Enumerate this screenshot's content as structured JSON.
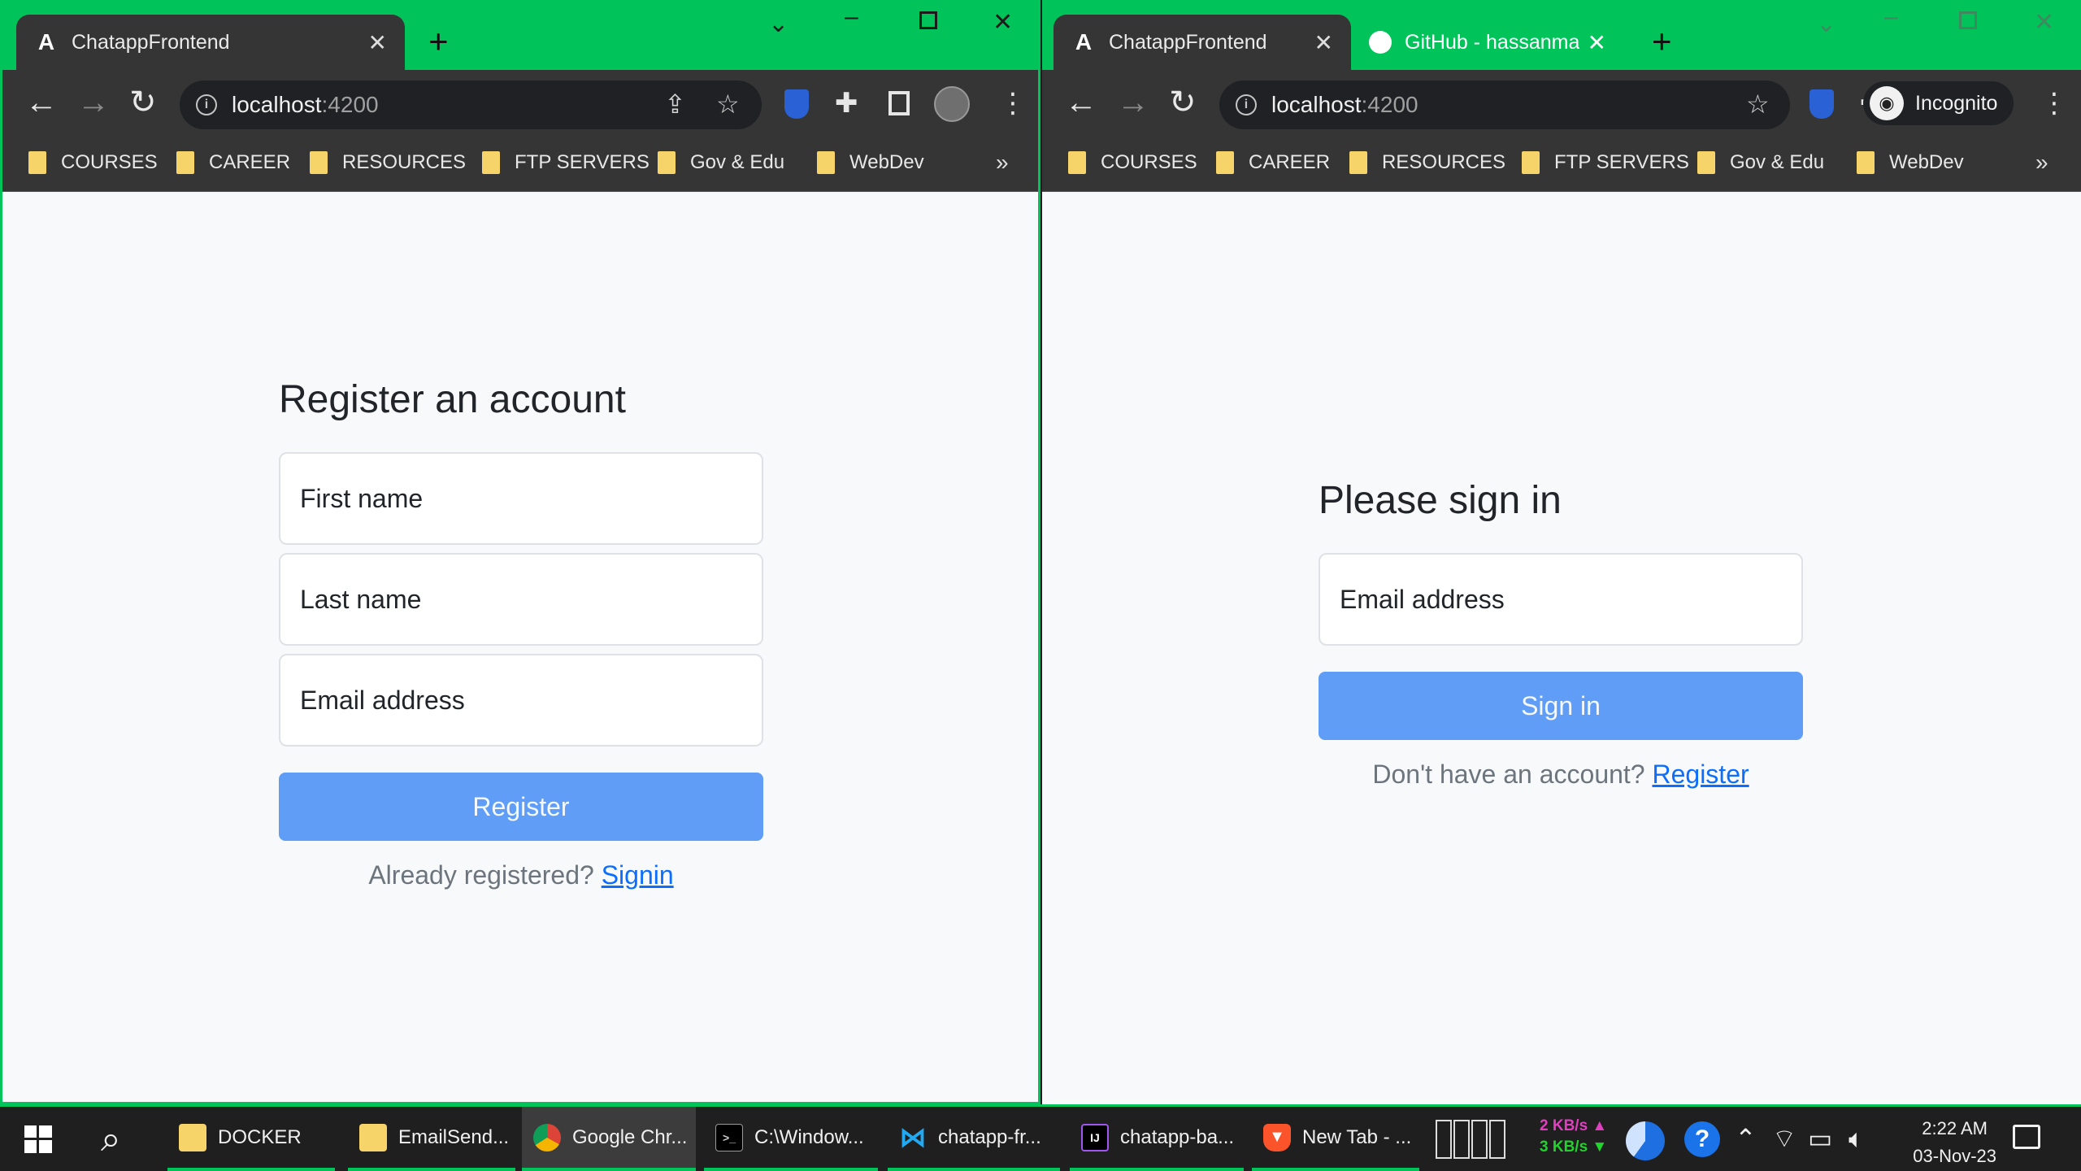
{
  "left_window": {
    "tab_title": "ChatappFrontend",
    "url_host": "localhost",
    "url_port": ":4200",
    "bookmarks": [
      "COURSES",
      "CAREER",
      "RESOURCES",
      "FTP SERVERS",
      "Gov & Edu",
      "WebDev"
    ],
    "form": {
      "title": "Register an account",
      "first_name": "First name",
      "last_name": "Last name",
      "email": "Email address",
      "button": "Register",
      "aux_text": "Already registered?",
      "aux_link": "Signin"
    }
  },
  "right_window": {
    "tab_title": "ChatappFrontend",
    "tab2_title": "GitHub - hassanmaht",
    "url_host": "localhost",
    "url_port": ":4200",
    "incognito_label": "Incognito",
    "bookmarks": [
      "COURSES",
      "CAREER",
      "RESOURCES",
      "FTP SERVERS",
      "Gov & Edu",
      "WebDev"
    ],
    "form": {
      "title": "Please sign in",
      "email": "Email address",
      "button": "Sign in",
      "aux_text": "Don't have an account?",
      "aux_link": "Register"
    }
  },
  "taskbar": {
    "items": [
      "DOCKER",
      "EmailSend...",
      "Google Chr...",
      "C:\\Window...",
      "chatapp-fr...",
      "chatapp-ba...",
      "New Tab - ..."
    ],
    "upload_speed": "2 KB/s",
    "download_speed": "3 KB/s",
    "time": "2:22 AM",
    "date": "03-Nov-23"
  },
  "colors": {
    "accent": "#00c45a",
    "primary_button": "#5f9df7",
    "link": "#0d6efd",
    "page_bg": "#f8f9fa"
  },
  "icons": [
    "angular-icon",
    "github-icon",
    "back-icon",
    "forward-icon",
    "reload-icon",
    "info-icon",
    "share-icon",
    "star-icon",
    "bitwarden-icon",
    "extensions-icon",
    "sidepanel-icon",
    "profile-avatar",
    "menu-icon",
    "incognito-icon",
    "folder-icon",
    "windows-start-icon",
    "search-icon",
    "wifi-icon",
    "battery-icon",
    "volume-icon",
    "notification-icon",
    "help-icon"
  ]
}
